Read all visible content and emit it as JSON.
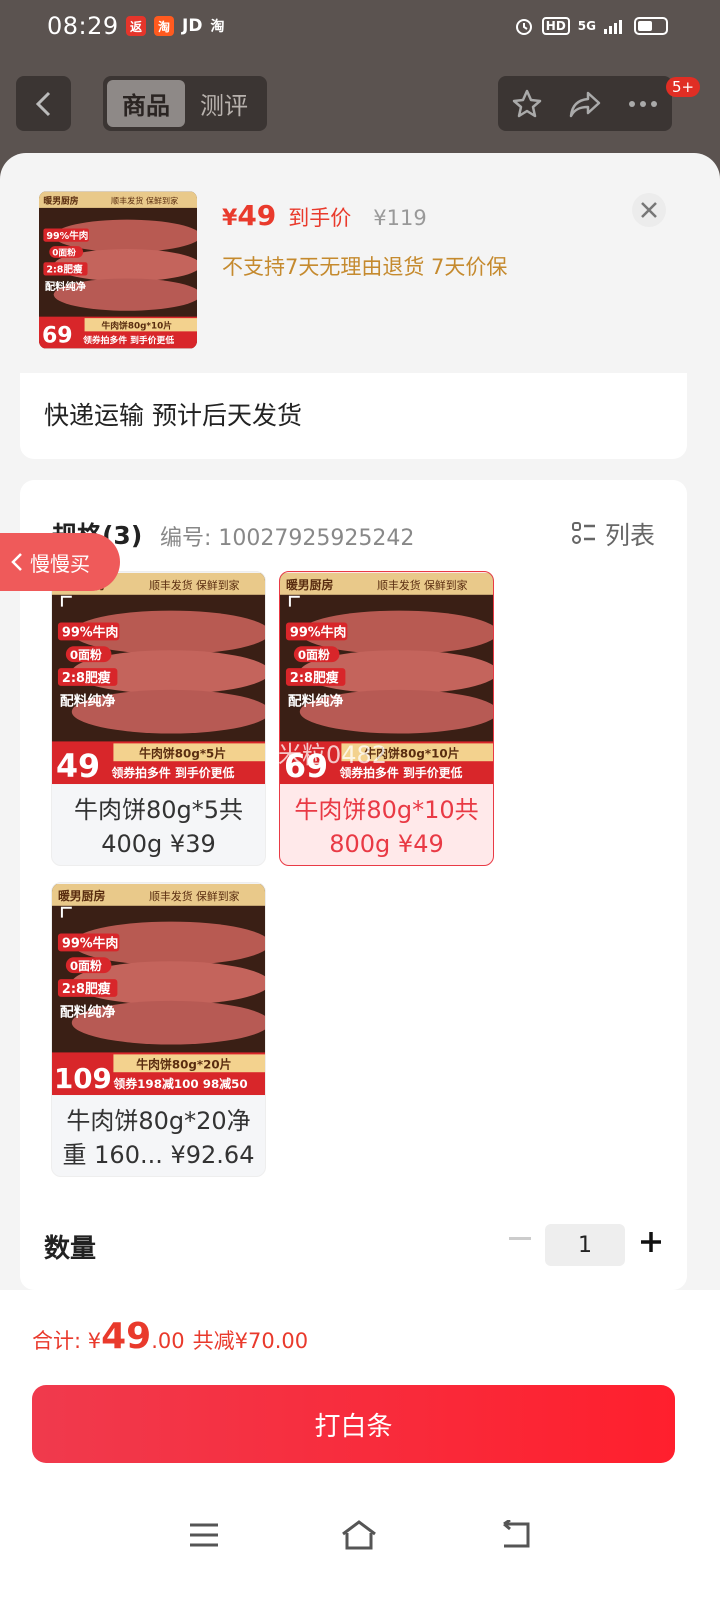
{
  "status_bar": {
    "time": "08:29",
    "apps": [
      "JD",
      "淘"
    ],
    "network": "5G",
    "hd": "HD"
  },
  "nav": {
    "tabs": [
      {
        "label": "商品",
        "active": true
      },
      {
        "label": "测评",
        "active": false
      }
    ],
    "badge": "5+"
  },
  "product": {
    "price_symbol": "¥",
    "price": "49",
    "price_tag": "到手价",
    "original_price": "¥119",
    "note": "不支持7天无理由退货  7天价保"
  },
  "shipping": {
    "text": "快递运输 预计后天发货"
  },
  "spec": {
    "title": "规格(3)",
    "number": "编号: 10027925925242",
    "list_toggle": "列表",
    "options": [
      {
        "label": "牛肉饼80g*5共400g ¥39",
        "img_price": "49",
        "img_desc": "牛肉饼80g*5片",
        "img_promo": "领券拍多件 到手价更低",
        "selected": false
      },
      {
        "label": "牛肉饼80g*10共800g ¥49",
        "img_price": "69",
        "img_desc": "牛肉饼80g*10片",
        "img_promo": "领券拍多件 到手价更低",
        "selected": true
      },
      {
        "label": "牛肉饼80g*20净重 160... ¥92.64",
        "img_price": "109",
        "img_desc": "牛肉饼80g*20片",
        "img_promo": "领券198减100 98减50",
        "selected": false
      }
    ],
    "img_brand": "暖男厨房",
    "img_ship": "顺丰发货 保鲜到家",
    "img_badge1": "99%牛肉",
    "img_badge2": "0面粉",
    "img_badge3": "2:8肥瘦",
    "img_badge4": "配料纯净",
    "img_price_prefix": "到手价"
  },
  "main_thumb": {
    "price": "69",
    "desc": "牛肉饼80g*10片",
    "promo": "领券拍多件 到手价更低"
  },
  "watermark": "米粒0482",
  "slow_buy": "慢慢买",
  "quantity": {
    "label": "数量",
    "value": "1"
  },
  "footer": {
    "total_label": "合计: ¥",
    "total_int": "49",
    "total_dec": ".00",
    "saving": "共减¥70.00",
    "cta": "打白条"
  },
  "colors": {
    "accent": "#e93a2c",
    "gold": "#c58a2e",
    "cta_start": "#f03a4d",
    "cta_end": "#ff1f2d"
  }
}
